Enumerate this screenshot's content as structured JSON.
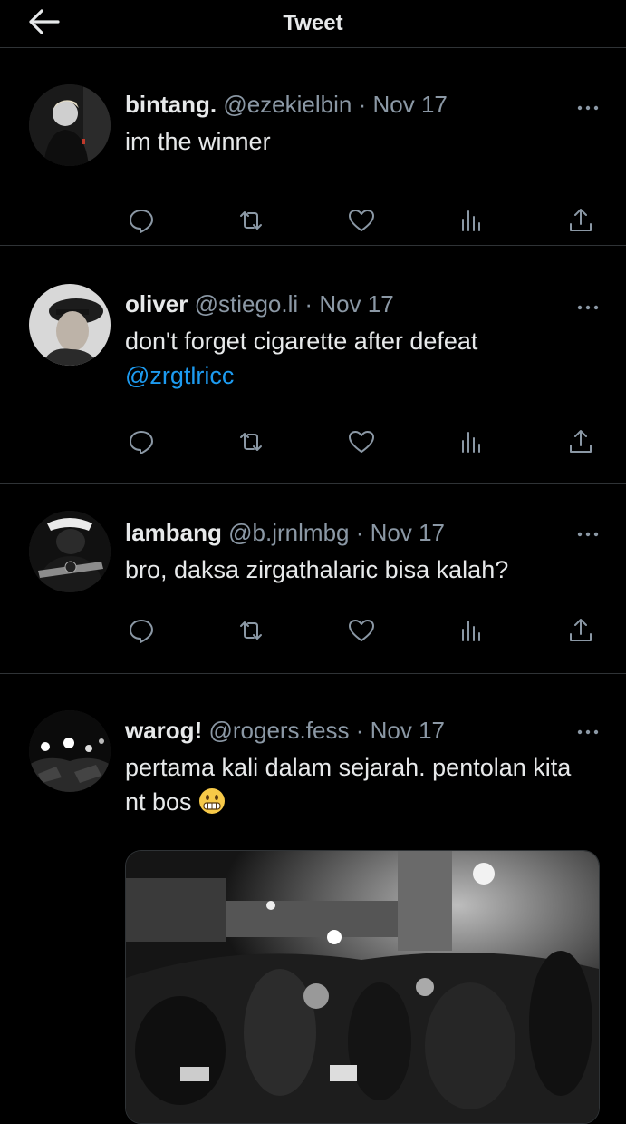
{
  "header": {
    "title": "Tweet",
    "back_icon": "arrow-left-icon"
  },
  "tweets": [
    {
      "name": "bintang.",
      "handle": "@ezekielbin",
      "dot": "·",
      "date": "Nov 17",
      "text": "im the winner",
      "mention": ""
    },
    {
      "name": "oliver",
      "handle": "@stiego.li",
      "dot": "·",
      "date": "Nov 17",
      "text": "don't forget cigarette after defeat",
      "mention": "@zrgtlricc"
    },
    {
      "name": "lambang",
      "handle": "@b.jrnlmbg",
      "dot": "·",
      "date": "Nov 17",
      "text": "bro, daksa zirgathalaric bisa kalah?",
      "mention": ""
    },
    {
      "name": "warog!",
      "handle": "@rogers.fess",
      "dot": "·",
      "date": "Nov 17",
      "text": "pertama kali dalam sejarah. pentolan kita nt bos",
      "mention": "",
      "emoji": "grimacing-face-emoji"
    }
  ],
  "icons": {
    "reply": "reply-icon",
    "retweet": "retweet-icon",
    "like": "heart-icon",
    "views": "views-icon",
    "share": "share-icon",
    "more": "more-icon"
  },
  "colors": {
    "background": "#000000",
    "text": "#e7e9ea",
    "secondary": "#8b98a5",
    "link": "#1d9bf0",
    "divider": "#2f3336"
  }
}
